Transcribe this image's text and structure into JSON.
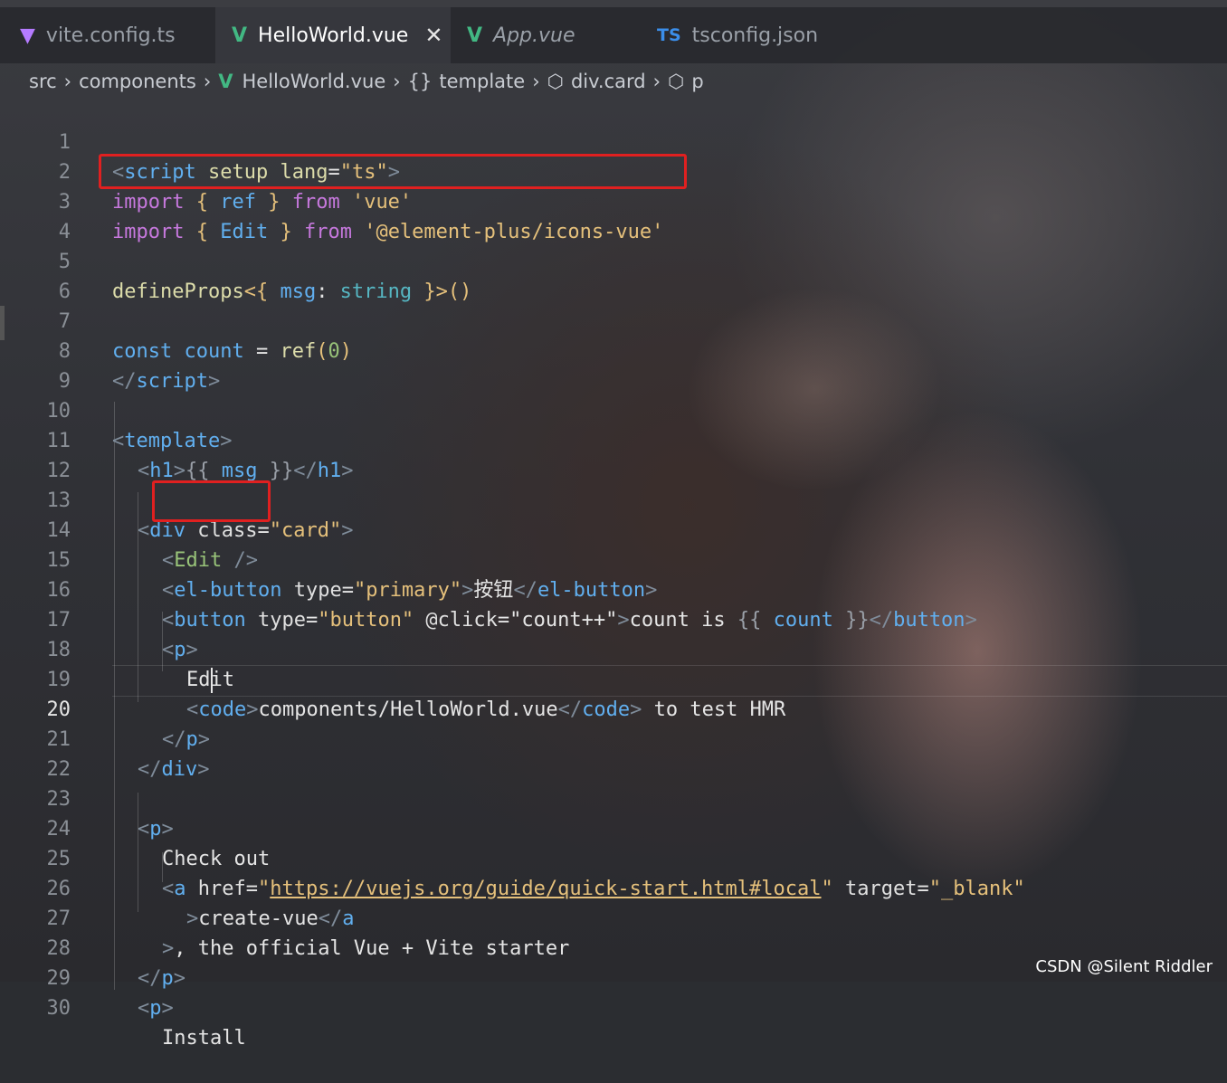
{
  "tabs": [
    {
      "label": "vite.config.ts",
      "icon": "vite-icon",
      "active": false
    },
    {
      "label": "HelloWorld.vue",
      "icon": "vue-icon",
      "active": true,
      "close": "✕"
    },
    {
      "label": "App.vue",
      "icon": "vue-icon",
      "active": false
    },
    {
      "label": "tsconfig.json",
      "icon": "ts-icon",
      "icon_text": "TS",
      "active": false
    }
  ],
  "breadcrumb": {
    "items": [
      "src",
      "components",
      "HelloWorld.vue",
      "template",
      "div.card",
      "p"
    ],
    "template_glyph": "{}"
  },
  "line_numbers": [
    "1",
    "2",
    "3",
    "4",
    "5",
    "6",
    "7",
    "8",
    "9",
    "10",
    "11",
    "12",
    "13",
    "14",
    "15",
    "16",
    "17",
    "18",
    "19",
    "20",
    "21",
    "22",
    "23",
    "24",
    "25",
    "26",
    "27",
    "28",
    "29",
    "30"
  ],
  "current_line": "20",
  "code": {
    "l1": [
      "<",
      "script",
      " setup",
      " lang",
      "=",
      "\"ts\"",
      ">"
    ],
    "l2": [
      "import",
      " {",
      " ref",
      " }",
      " from",
      " 'vue'"
    ],
    "l3": [
      "import",
      " {",
      " Edit",
      " }",
      " from",
      " '@element-plus/icons-vue'"
    ],
    "l5": [
      "defineProps",
      "<{",
      " msg",
      ":",
      " string",
      " }>",
      "()"
    ],
    "l7": [
      "const",
      " count",
      " =",
      " ref",
      "(",
      "0",
      ")"
    ],
    "l8": [
      "</",
      "script",
      ">"
    ],
    "l10": [
      "<",
      "template",
      ">"
    ],
    "l11": [
      "<",
      "h1",
      ">",
      "{{",
      " msg",
      " }}",
      "</",
      "h1",
      ">"
    ],
    "l13": [
      "<",
      "div",
      " class",
      "=",
      "\"card\"",
      ">"
    ],
    "l14": [
      "<",
      "Edit",
      " />"
    ],
    "l15": [
      "<",
      "el-button",
      " type",
      "=",
      "\"primary\"",
      ">",
      "按钮",
      "</",
      "el-button",
      ">"
    ],
    "l16": [
      "<",
      "button",
      " type",
      "=",
      "\"button\"",
      " @click",
      "=",
      "\"count++\"",
      ">",
      "count is ",
      "{{",
      " count",
      " }}",
      "</",
      "button",
      ">"
    ],
    "l17": [
      "<",
      "p",
      ">"
    ],
    "l18": [
      "Edit"
    ],
    "l19": [
      "<",
      "code",
      ">",
      "components/HelloWorld.vue",
      "</",
      "code",
      ">",
      " to test HMR"
    ],
    "l20": [
      "</",
      "p",
      ">"
    ],
    "l21": [
      "</",
      "div",
      ">"
    ],
    "l23": [
      "<",
      "p",
      ">"
    ],
    "l24": [
      "Check out"
    ],
    "l25": [
      "<",
      "a",
      " href",
      "=",
      "\"",
      "https://vuejs.org/guide/quick-start.html#local",
      "\"",
      " target",
      "=",
      "\"_blank\""
    ],
    "l26": [
      ">",
      "create-vue",
      "</",
      "a"
    ],
    "l27": [
      ">",
      ", the official Vue + Vite starter"
    ],
    "l28": [
      "</",
      "p",
      ">"
    ],
    "l29": [
      "<",
      "p",
      ">"
    ],
    "l30": [
      "Install"
    ]
  },
  "watermark": "CSDN @Silent Riddler",
  "colors": {
    "highlight_box": "#e02020",
    "vue_green": "#42b883"
  }
}
